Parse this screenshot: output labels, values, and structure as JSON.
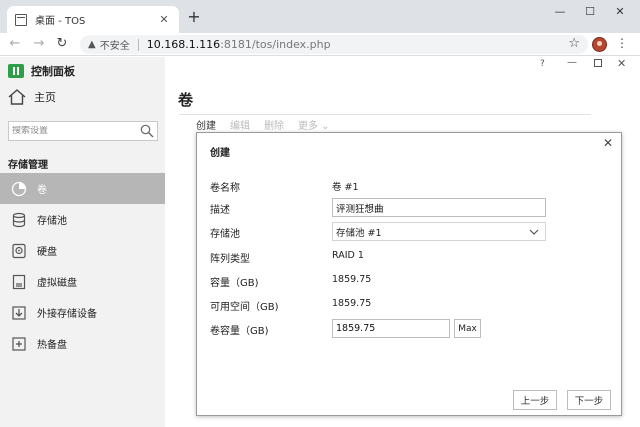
{
  "browser": {
    "tab_title": "桌面 - TOS",
    "tab_close": "✕",
    "new_tab": "+",
    "win_min": "—",
    "win_max": "☐",
    "win_close": "✕",
    "back": "←",
    "forward": "→",
    "reload": "↻",
    "warning_glyph": "▲",
    "insecure_label": "不安全",
    "url_host": "10.168.1.116",
    "url_path": ":8181/tos/index.php",
    "star": "☆",
    "menu": "⋮"
  },
  "sidebar": {
    "title": "控制面板",
    "home": "主页",
    "search_placeholder": "搜索设置",
    "section": "存储管理",
    "items": [
      {
        "label": "卷",
        "icon": "pie-chart-icon",
        "active": true
      },
      {
        "label": "存储池",
        "icon": "database-icon",
        "active": false
      },
      {
        "label": "硬盘",
        "icon": "hard-disk-icon",
        "active": false
      },
      {
        "label": "虚拟磁盘",
        "icon": "virtual-disk-icon",
        "active": false
      },
      {
        "label": "外接存储设备",
        "icon": "external-storage-icon",
        "active": false
      },
      {
        "label": "热备盘",
        "icon": "hot-spare-icon",
        "active": false
      }
    ]
  },
  "main": {
    "win_help": "?",
    "win_min": "—",
    "win_close": "✕",
    "title": "卷",
    "actions": {
      "create": "创建",
      "edit": "编辑",
      "delete": "删除",
      "more": "更多 ⌄"
    }
  },
  "dialog": {
    "title": "创建",
    "close": "✕",
    "name_label": "卷名称",
    "name_value": "卷 #1",
    "desc_label": "描述",
    "desc_value": "评测狂想曲",
    "pool_label": "存储池",
    "pool_value": "存储池 #1",
    "raid_label": "阵列类型",
    "raid_value": "RAID 1",
    "capacity_label": "容量（GB)",
    "capacity_value": "1859.75",
    "free_label": "可用空间（GB)",
    "free_value": "1859.75",
    "vol_cap_label": "卷容量（GB)",
    "vol_cap_value": "1859.75",
    "max_button": "Max",
    "prev_button": "上一步",
    "next_button": "下一步"
  }
}
